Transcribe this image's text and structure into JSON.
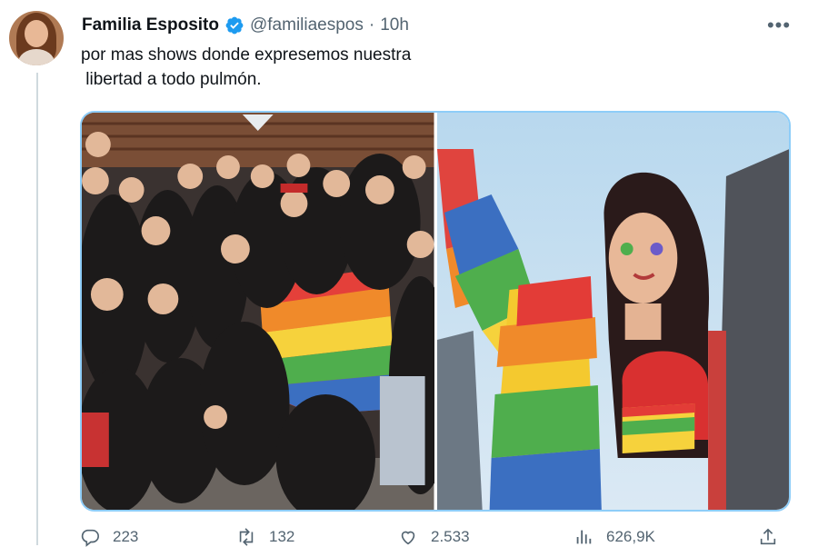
{
  "author": {
    "display_name": "Familia Esposito",
    "handle": "@familiaespos",
    "separator": "·",
    "time": "10h",
    "verified": true
  },
  "tweet": {
    "text_line1": "por mas shows donde expresemos nuestra",
    "text_line2": " libertad a todo pulmón."
  },
  "media": {
    "count": 2,
    "border_color": "#8ecdf8"
  },
  "actions": {
    "replies": "223",
    "retweets": "132",
    "likes": "2.533",
    "views": "626,9K"
  },
  "colors": {
    "text": "#0f1419",
    "secondary": "#536471",
    "verified": "#1d9bf0",
    "thread_line": "#cfd9de"
  },
  "icons": [
    "verified-badge-icon",
    "more-options-icon",
    "reply-icon",
    "retweet-icon",
    "like-icon",
    "views-icon",
    "share-icon"
  ]
}
